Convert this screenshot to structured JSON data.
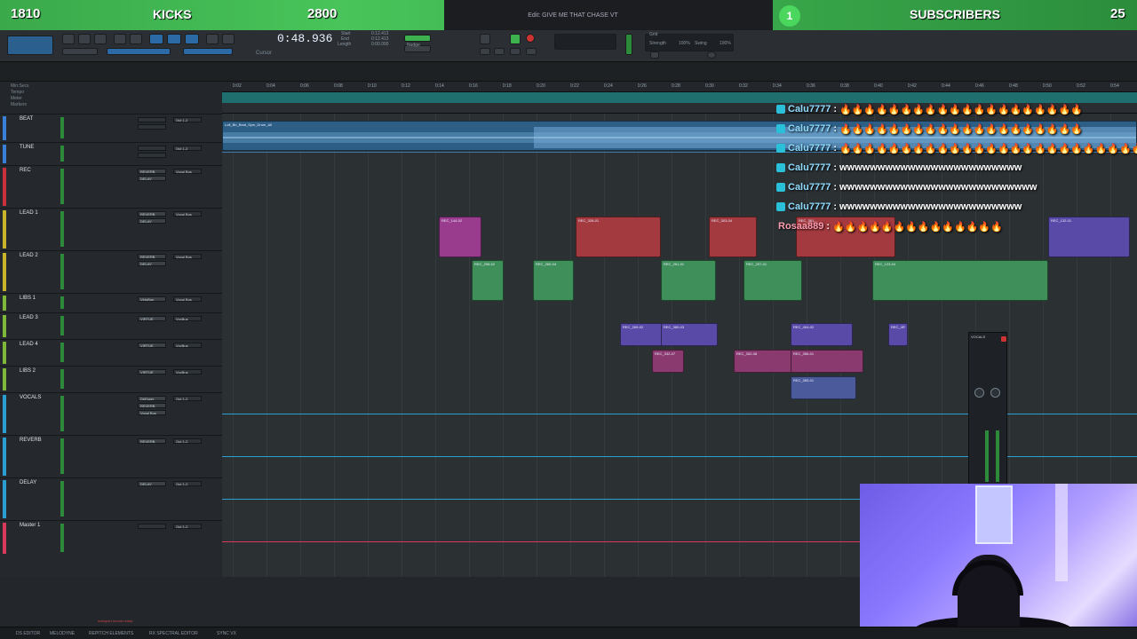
{
  "overlay": {
    "kicks_count": "1810",
    "kicks_label": "KICKS",
    "kicks_goal": "2800",
    "subs_count": "1",
    "subs_label": "SUBSCRIBERS",
    "subs_goal": "25"
  },
  "window": {
    "title": "Edit: GIVE ME THAT CHASE VT"
  },
  "transport": {
    "main_counter": "0:48.936",
    "counter_label": "Cursor",
    "start_label": "Start",
    "end_label": "End",
    "length_label": "Length",
    "start_value": "0:12.413",
    "end_value": "0:12.413",
    "length_value": "0:00.000",
    "grid_label": "Grid",
    "nudge_label": "Nudge",
    "strength_label": "Strength",
    "swing_label": "Swing",
    "strength_value": "100%",
    "swing_value": "100%"
  },
  "rulers": {
    "labels": [
      "Min:Secs",
      "Tempo",
      "Meter",
      "Markers"
    ],
    "ticks": [
      "0:02",
      "0:04",
      "0:06",
      "0:08",
      "0:10",
      "0:12",
      "0:14",
      "0:16",
      "0:18",
      "0:20",
      "0:22",
      "0:24",
      "0:26",
      "0:28",
      "0:30",
      "0:32",
      "0:34",
      "0:36",
      "0:38",
      "0:40",
      "0:42",
      "0:44",
      "0:46",
      "0:48",
      "0:50",
      "0:52",
      "0:54"
    ]
  },
  "tracks": [
    {
      "name": "BEAT",
      "color": "#3a7fd8",
      "inserts": [
        "",
        ""
      ],
      "output": "Out 1-2"
    },
    {
      "name": "TUNE",
      "color": "#3a7fd8",
      "inserts": [
        "",
        ""
      ],
      "output": "Out 1-2"
    },
    {
      "name": "REC",
      "color": "#c9313c",
      "inserts": [
        "REVERB",
        "DELAY"
      ],
      "output": "Vocal Bus"
    },
    {
      "name": "LEAD 1",
      "color": "#c8b52c",
      "inserts": [
        "REVERB",
        "DELAY"
      ],
      "output": "Vocal Bus"
    },
    {
      "name": "LEAD 2",
      "color": "#c8b52c",
      "inserts": [
        "REVERB",
        "DELAY"
      ],
      "output": "Vocal Bus"
    },
    {
      "name": "LIBS 1",
      "color": "#7db83a",
      "inserts": [
        "VirtuBus"
      ],
      "output": "Vocal Bus"
    },
    {
      "name": "LEAD 3",
      "color": "#7db83a",
      "inserts": [
        "VIRTUE"
      ],
      "output": "VocBus"
    },
    {
      "name": "LEAD 4",
      "color": "#7db83a",
      "inserts": [
        "VIRTUE"
      ],
      "output": "VocBus"
    },
    {
      "name": "LIBS 2",
      "color": "#7db83a",
      "inserts": [
        "VIRTUE"
      ],
      "output": "VocBus"
    },
    {
      "name": "VOCALS",
      "color": "#2c9fd1",
      "inserts": [
        "DeEsser",
        "REVERB",
        "Vocal Bus"
      ],
      "output": "Out 1-2"
    },
    {
      "name": "REVERB",
      "color": "#2c9fd1",
      "inserts": [
        "REVERB"
      ],
      "output": "Out 1-2"
    },
    {
      "name": "DELAY",
      "color": "#2c9fd1",
      "inserts": [
        "DELAY"
      ],
      "output": "Out 1-2"
    },
    {
      "name": "Master 1",
      "color": "#d83a5b",
      "inserts": [
        ""
      ],
      "output": "Out 1-2"
    }
  ],
  "clips": {
    "beat": "Lofi_Bb_Beat_Sym_Drum_All",
    "lead1": [
      "REC_144-02",
      "REC_326-01",
      "REC_303-04",
      "REC_361-...",
      "REC_132-01"
    ],
    "lead2": [
      "REC_258-02",
      "REC_260-04",
      "REC_261-01",
      "REC_257-01",
      "REC_123-04"
    ],
    "lead3": [
      "REC_269-02",
      "REC_380-03",
      "REC_404-02",
      "REC_4R"
    ],
    "lead4": [
      "REC_332-07",
      "REC_352-08",
      "REC_356-01"
    ],
    "libs2": [
      "REC_365-01"
    ]
  },
  "chat": [
    {
      "user": "Calu7777",
      "message": "🔥🔥🔥🔥🔥🔥🔥🔥🔥🔥🔥🔥🔥🔥🔥🔥🔥🔥🔥🔥",
      "pink": false
    },
    {
      "user": "Calu7777",
      "message": "🔥🔥🔥🔥🔥🔥🔥🔥🔥🔥🔥🔥🔥🔥🔥🔥🔥🔥🔥🔥",
      "pink": false
    },
    {
      "user": "Calu7777",
      "message": "🔥🔥🔥🔥🔥🔥🔥🔥🔥🔥🔥🔥🔥🔥🔥🔥🔥🔥🔥🔥🔥🔥🔥🔥🔥🔥🔥🔥",
      "pink": false
    },
    {
      "user": "Calu7777",
      "message": "wwwwwwwwwwwwwwwwwwwwwwww",
      "pink": false
    },
    {
      "user": "Calu7777",
      "message": "wwwwwwwwwwwwwwwwwwwwwwwwww",
      "pink": false
    },
    {
      "user": "Calu7777",
      "message": "wwwwwwwwwwwwwwwwwwwwwwww",
      "pink": false
    },
    {
      "user": "Rosaa889",
      "message": "🔥🔥🔥🔥🔥🔥🔥🔥🔥🔥🔥🔥🔥🔥",
      "pink": true
    }
  ],
  "plugin": {
    "title": "VOCALS"
  },
  "status": {
    "items": [
      "DS EDITOR",
      "MELODYNE",
      "REPITCH ELEMENTS",
      "RX SPECTRAL EDITOR",
      "SYNC VX"
    ],
    "notice": "transport record ready"
  },
  "colors": {
    "banner_green": "#48c45a",
    "timeline_teal": "#1f6f6f",
    "clip_pink": "#b0479a",
    "clip_red": "#a33a40",
    "clip_green": "#3e8f5a",
    "clip_purple": "#5a4aa8"
  }
}
